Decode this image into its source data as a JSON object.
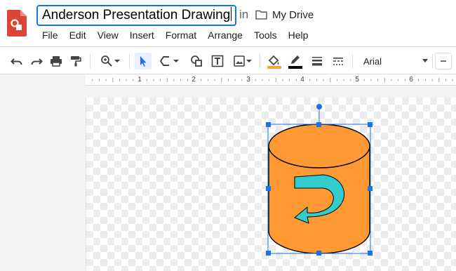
{
  "document": {
    "title": "Anderson Presentation Drawing",
    "location_prefix": "in",
    "folder": "My Drive"
  },
  "menu": [
    "File",
    "Edit",
    "View",
    "Insert",
    "Format",
    "Arrange",
    "Tools",
    "Help"
  ],
  "toolbar": {
    "icons": [
      "undo-icon",
      "redo-icon",
      "print-icon",
      "paint-format-icon",
      "zoom-icon",
      "select-icon",
      "line-icon",
      "shape-icon",
      "text-box-icon",
      "image-icon",
      "fill-color-icon",
      "border-color-icon",
      "border-weight-icon",
      "border-dash-icon"
    ],
    "font": "Arial",
    "fill_color": "#f4a53a",
    "border_color": "#000000"
  },
  "ruler": {
    "labels": [
      "1",
      "2",
      "3",
      "4",
      "5",
      "6"
    ]
  },
  "drawing": {
    "shape": "cylinder",
    "fill": "#ff9933",
    "arrow_fill": "#33cccc",
    "selection_color": "#1a73e8"
  }
}
